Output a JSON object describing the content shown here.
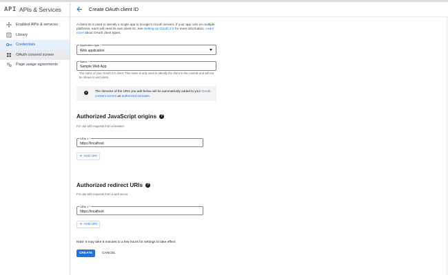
{
  "brand": {
    "logo": "API",
    "title": "APIs & Services"
  },
  "sidebar": {
    "items": [
      {
        "label": "Enabled APIs & services",
        "icon": "settings-dots-icon",
        "state": ""
      },
      {
        "label": "Library",
        "icon": "library-icon",
        "state": ""
      },
      {
        "label": "Credentials",
        "icon": "key-icon",
        "state": "active"
      },
      {
        "label": "OAuth consent screen",
        "icon": "grid-icon",
        "state": "hover"
      },
      {
        "label": "Page usage agreements",
        "icon": "settings-list-icon",
        "state": ""
      }
    ]
  },
  "header": {
    "title": "Create OAuth client ID"
  },
  "intro": {
    "part1": "A client ID is used to identify a single app to Google's OAuth servers. If your app runs on multiple platforms, each will need its own client ID. See ",
    "link1": "Setting up OAuth 2.0",
    "part2": " for more information. ",
    "link2": "Learn more",
    "part3": " about OAuth client types."
  },
  "application_type": {
    "label": "Application type *",
    "value": "Web application"
  },
  "name_field": {
    "label": "Name *",
    "value": "Sample Web App",
    "hint": "The name of your OAuth 2.0 client. This name is only used to identify the client in the console and will not be shown to end users."
  },
  "info": {
    "text": "The domains of the URIs you add below will be automatically added to your ",
    "link1": "OAuth consent screen",
    "mid": " as ",
    "link2": "authorized domains",
    "end": "."
  },
  "js_origins": {
    "title": "Authorized JavaScript origins",
    "subtitle": "For use with requests from a browser",
    "uri_label": "URIs 1 *",
    "uri_value": "https://localhost",
    "add_label": "ADD URI"
  },
  "redirect_uris": {
    "title": "Authorized redirect URIs",
    "subtitle": "For use with requests from a web server",
    "uri_label": "URIs 1 *",
    "uri_value": "https://localhost",
    "add_label": "ADD URI"
  },
  "note": "Note: It may take 5 minutes to a few hours for settings to take effect",
  "actions": {
    "create": "CREATE",
    "cancel": "CANCEL"
  },
  "colors": {
    "accent": "#1a73e8",
    "active_bg": "#e8f0fe",
    "info_bg": "#f1f3f4"
  }
}
